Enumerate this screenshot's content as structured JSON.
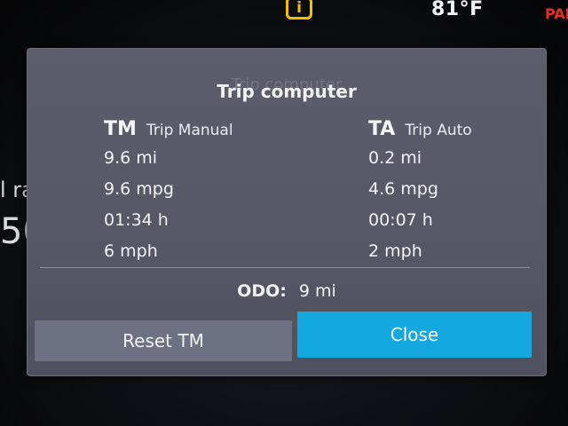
{
  "status_bar": {
    "warning_icon": "info-warning-icon",
    "warning_glyph": "i",
    "temperature": "81°F",
    "park_indicator": "PAR"
  },
  "background": {
    "fragment_1": "l ra",
    "fragment_2": "50"
  },
  "dialog": {
    "title": "Trip computer",
    "ghost_title": "Trip computer",
    "trip_manual": {
      "abbr": "TM",
      "name": "Trip Manual",
      "distance": "9.6 mi",
      "consumption": "9.6 mpg",
      "time": "01:34 h",
      "speed": "6 mph"
    },
    "trip_auto": {
      "abbr": "TA",
      "name": "Trip Auto",
      "distance": "0.2 mi",
      "consumption": "4.6 mpg",
      "time": "00:07 h",
      "speed": "2 mph"
    },
    "odometer": {
      "label": "ODO:",
      "value": "9 mi"
    },
    "reset_label": "Reset TM",
    "close_label": "Close"
  },
  "colors": {
    "accent": "#14a8de",
    "warning": "#f2c200",
    "park": "#e5301f"
  }
}
